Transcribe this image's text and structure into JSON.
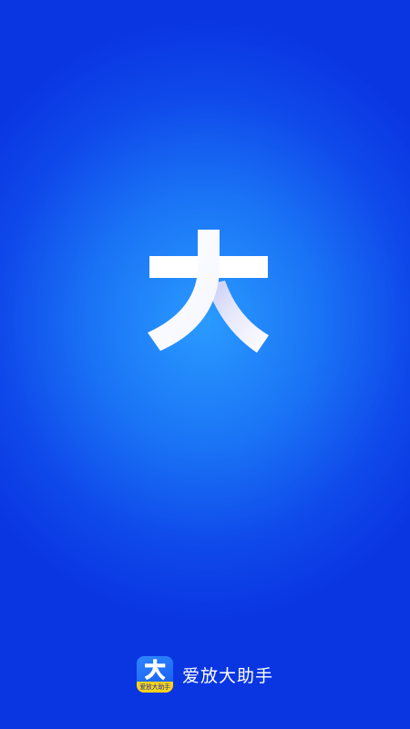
{
  "splash": {
    "logo_icon": "da-character-logo",
    "background_colors": [
      "#2a9bff",
      "#1a73f5",
      "#0f49ea",
      "#0a36e2"
    ]
  },
  "footer": {
    "app_icon": "da-character-logo",
    "app_icon_badge_text": "爱放大助手",
    "app_name": "爱放大助手",
    "accent_color": "#ffd21a"
  }
}
